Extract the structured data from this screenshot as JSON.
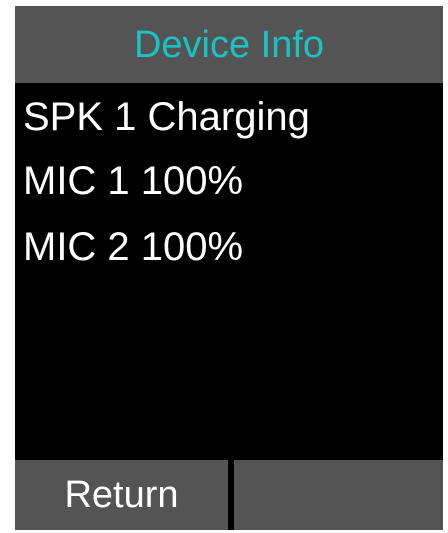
{
  "header": {
    "title": "Device Info"
  },
  "info_rows": [
    {
      "label": "SPK 1 Charging"
    },
    {
      "label": "MIC 1 100%"
    },
    {
      "label": "MIC 2 100%"
    }
  ],
  "softkeys": {
    "left_label": "Return",
    "right_label": ""
  },
  "colors": {
    "title_accent": "#19c3c3",
    "bar_background": "#545454",
    "screen_background": "#000000",
    "text": "#ffffff"
  }
}
